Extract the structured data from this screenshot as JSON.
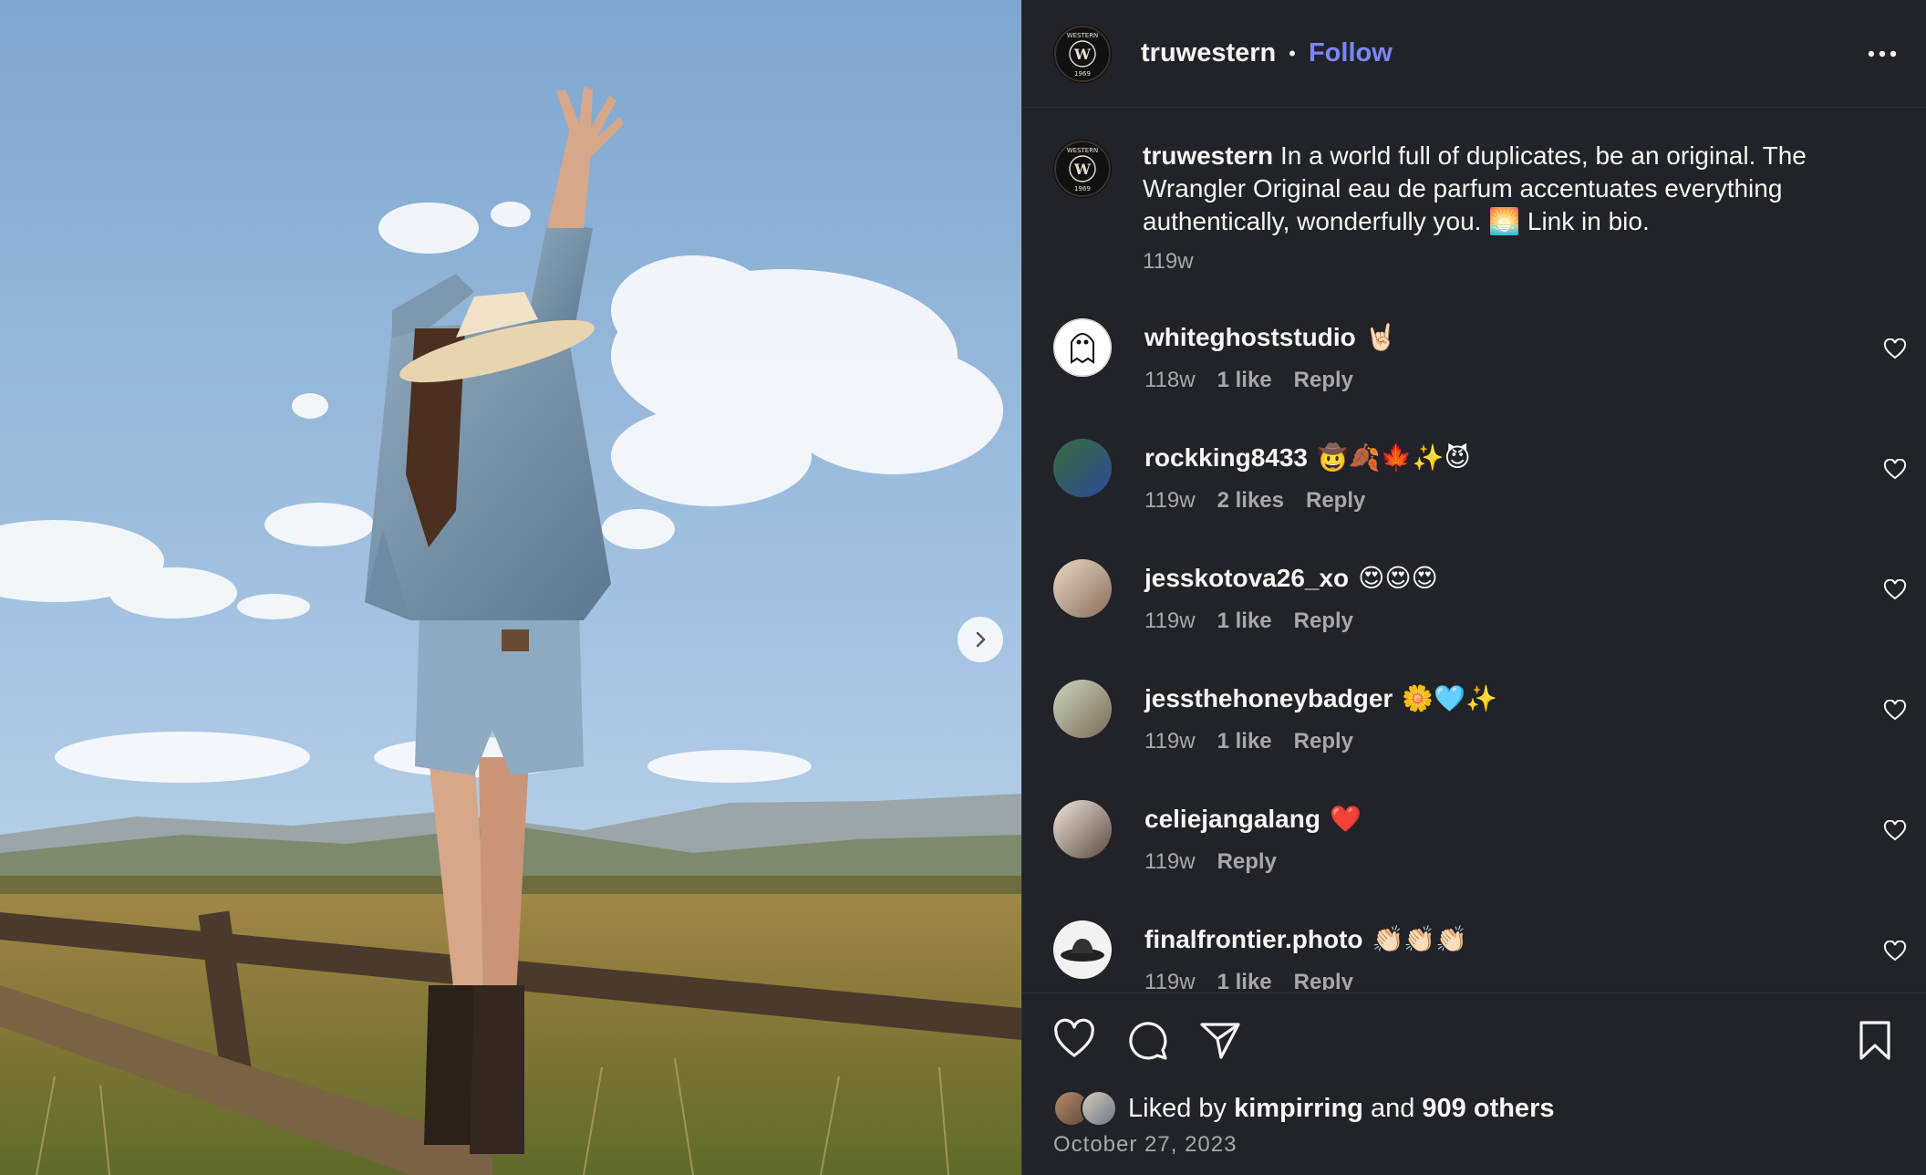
{
  "post": {
    "username": "truwestern",
    "separator": "•",
    "follow_label": "Follow",
    "logo_text": {
      "top": "TRU WESTERN",
      "letter": "W",
      "year": "1969"
    }
  },
  "caption": {
    "username": "truwestern",
    "text": "In a world full of duplicates, be an original. The Wrangler Original eau de parfum accentuates everything authentically, wonderfully you. 🌅 Link in bio.",
    "time": "119w"
  },
  "comments": [
    {
      "username": "whiteghoststudio",
      "text": "🤘🏻",
      "time": "118w",
      "likes": "1 like",
      "reply": "Reply"
    },
    {
      "username": "rockking8433",
      "text": "🤠🍂🍁✨😈",
      "time": "119w",
      "likes": "2 likes",
      "reply": "Reply"
    },
    {
      "username": "jesskotova26_xo",
      "text": "😍😍😍",
      "time": "119w",
      "likes": "1 like",
      "reply": "Reply"
    },
    {
      "username": "jessthehoneybadger",
      "text": "🌼🩵✨",
      "time": "119w",
      "likes": "1 like",
      "reply": "Reply"
    },
    {
      "username": "celiejangalang",
      "text": "❤️",
      "time": "119w",
      "likes": "",
      "reply": "Reply"
    },
    {
      "username": "finalfrontier.photo",
      "text": "👏🏻👏🏻👏🏻",
      "time": "119w",
      "likes": "1 like",
      "reply": "Reply"
    }
  ],
  "likes": {
    "prefix": "Liked by",
    "user": "kimpirring",
    "and": "and",
    "others": "909 others"
  },
  "date": "October 27, 2023",
  "colors": {
    "panel_bg": "#212328",
    "follow_blue": "#7b86ff",
    "muted": "#a8a8a8"
  },
  "icons": [
    "more-icon",
    "next-arrow-icon",
    "heart-icon",
    "comment-icon",
    "share-icon",
    "bookmark-icon"
  ]
}
